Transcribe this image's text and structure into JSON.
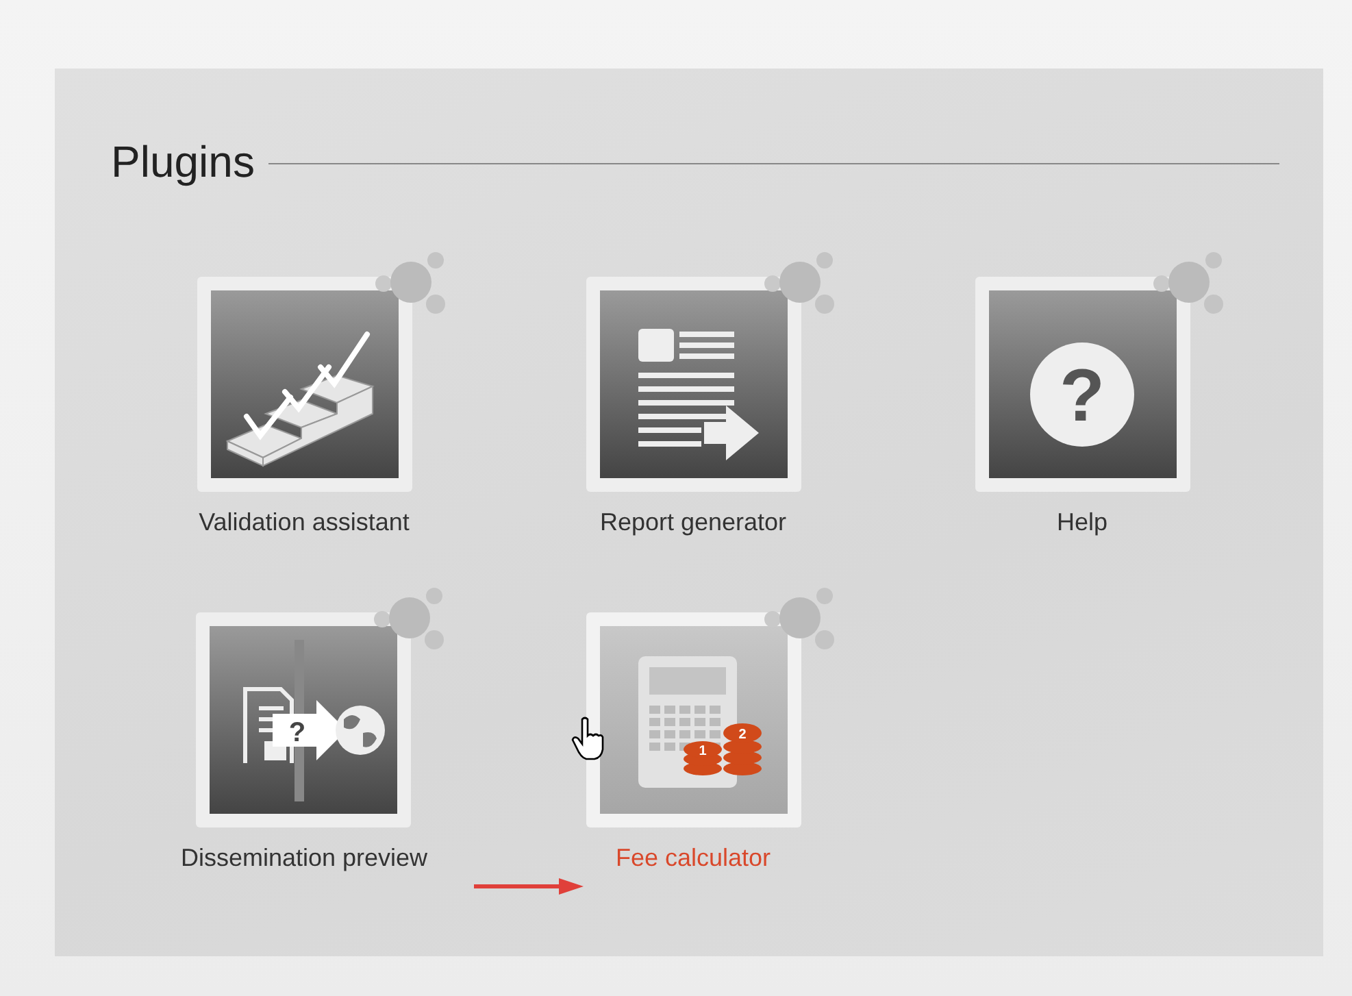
{
  "section": {
    "title": "Plugins"
  },
  "plugins": [
    {
      "kind": "validation",
      "label": "Validation assistant",
      "selected": false
    },
    {
      "kind": "report",
      "label": "Report generator",
      "selected": false
    },
    {
      "kind": "help",
      "label": "Help",
      "selected": false,
      "glyphs": [
        "?"
      ]
    },
    {
      "kind": "dissemination",
      "label": "Dissemination preview",
      "selected": false,
      "glyphs": [
        "?"
      ]
    },
    {
      "kind": "fee",
      "label": "Fee calculator",
      "selected": true,
      "glyphs": [
        "1",
        "2"
      ]
    }
  ]
}
